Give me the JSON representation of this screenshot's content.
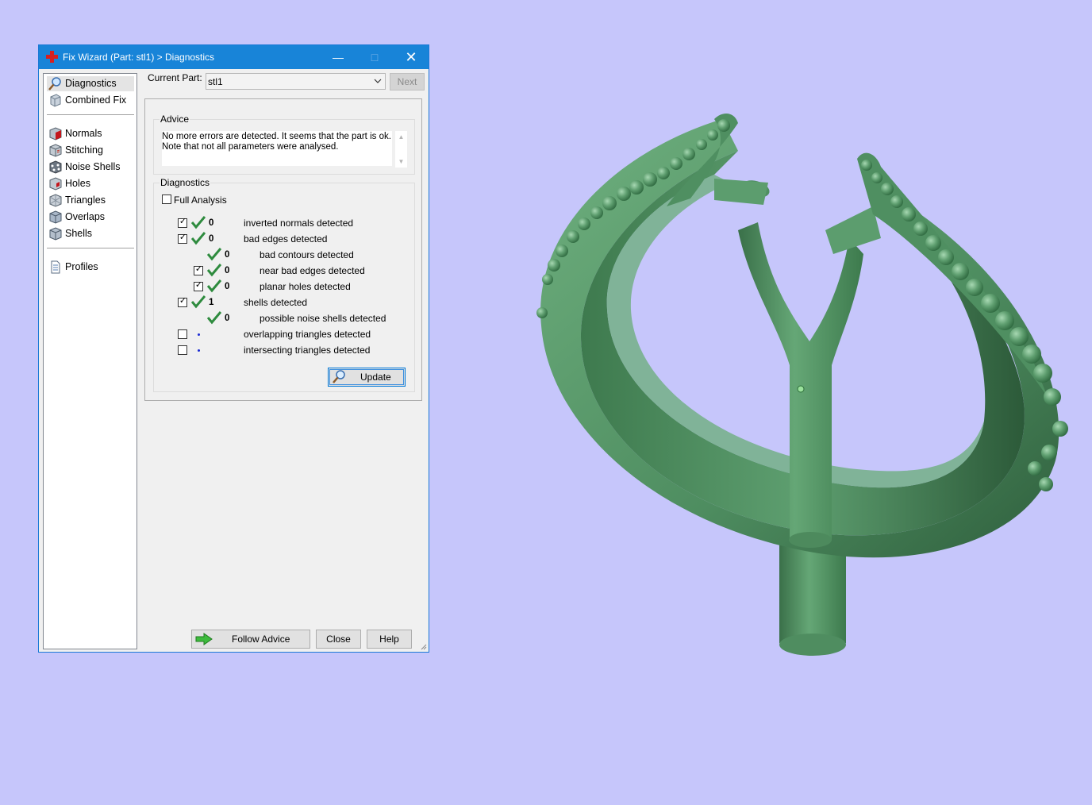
{
  "window": {
    "title": "Fix Wizard (Part: stl1) > Diagnostics",
    "minimize": "—",
    "maximize": "□",
    "close": "✕"
  },
  "nav": {
    "items": [
      {
        "label": "Diagnostics",
        "icon": "magnifier-icon",
        "selected": true
      },
      {
        "label": "Combined Fix",
        "icon": "part-icon"
      },
      {
        "label": "Normals",
        "icon": "normals-cube-icon"
      },
      {
        "label": "Stitching",
        "icon": "stitching-cube-icon"
      },
      {
        "label": "Noise Shells",
        "icon": "noise-shells-icon"
      },
      {
        "label": "Holes",
        "icon": "holes-cube-icon"
      },
      {
        "label": "Triangles",
        "icon": "triangles-cube-icon"
      },
      {
        "label": "Overlaps",
        "icon": "overlaps-cube-icon"
      },
      {
        "label": "Shells",
        "icon": "shells-cube-icon"
      },
      {
        "label": "Profiles",
        "icon": "document-icon"
      }
    ]
  },
  "current_part": {
    "label": "Current Part:",
    "value": "stl1",
    "next_label": "Next"
  },
  "advice": {
    "title": "Advice",
    "line1": "No more errors are detected. It seems that the part is ok.",
    "line2": "Note that not all parameters were analysed."
  },
  "diagnostics": {
    "title": "Diagnostics",
    "full_analysis_label": "Full Analysis",
    "full_analysis_checked": false,
    "rows": [
      {
        "label": "inverted normals detected",
        "count": "0",
        "checked": true,
        "status": "ok"
      },
      {
        "label": "bad edges detected",
        "count": "0",
        "checked": true,
        "status": "ok"
      },
      {
        "label": "bad contours detected",
        "count": "0",
        "checked": null,
        "status": "ok"
      },
      {
        "label": "near bad edges detected",
        "count": "0",
        "checked": true,
        "status": "ok"
      },
      {
        "label": "planar holes detected",
        "count": "0",
        "checked": true,
        "status": "ok"
      },
      {
        "label": "shells detected",
        "count": "1",
        "checked": true,
        "status": "ok"
      },
      {
        "label": "possible noise shells detected",
        "count": "0",
        "checked": null,
        "status": "ok"
      },
      {
        "label": "overlapping triangles detected",
        "count": "",
        "checked": false,
        "status": "not-analysed"
      },
      {
        "label": "intersecting triangles detected",
        "count": "",
        "checked": false,
        "status": "not-analysed"
      }
    ],
    "update_label": "Update"
  },
  "footer": {
    "follow_label": "Follow Advice",
    "close_label": "Close",
    "help_label": "Help"
  },
  "colors": {
    "viewport_bg": "#c6c6fb",
    "model": "#5a9c6c",
    "titlebar": "#1884d8",
    "ok_check": "#2e8b3e",
    "dot": "#1b2bd4"
  }
}
